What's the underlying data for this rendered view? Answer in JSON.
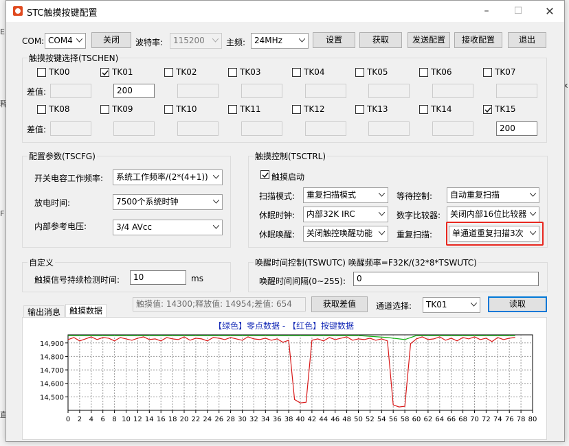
{
  "window": {
    "title": "STC触摸按键配置"
  },
  "toolbar": {
    "com_label": "COM:",
    "com_value": "COM4",
    "close_label": "关闭",
    "baud_label": "波特率:",
    "baud_value": "115200",
    "freq_label": "主频:",
    "freq_value": "24MHz",
    "set_label": "设置",
    "get_label": "获取",
    "send_config_label": "发送配置",
    "receive_config_label": "接收配置",
    "exit_label": "退出"
  },
  "tschen": {
    "title": "触摸按键选择(TSCHEN)",
    "diff_label": "差值:",
    "keys": [
      {
        "name": "TK00",
        "checked": false,
        "value": ""
      },
      {
        "name": "TK01",
        "checked": true,
        "value": "200"
      },
      {
        "name": "TK02",
        "checked": false,
        "value": ""
      },
      {
        "name": "TK03",
        "checked": false,
        "value": ""
      },
      {
        "name": "TK04",
        "checked": false,
        "value": ""
      },
      {
        "name": "TK05",
        "checked": false,
        "value": ""
      },
      {
        "name": "TK06",
        "checked": false,
        "value": ""
      },
      {
        "name": "TK07",
        "checked": false,
        "value": ""
      },
      {
        "name": "TK08",
        "checked": false,
        "value": ""
      },
      {
        "name": "TK09",
        "checked": false,
        "value": ""
      },
      {
        "name": "TK10",
        "checked": false,
        "value": ""
      },
      {
        "name": "TK11",
        "checked": false,
        "value": ""
      },
      {
        "name": "TK12",
        "checked": false,
        "value": ""
      },
      {
        "name": "TK13",
        "checked": false,
        "value": ""
      },
      {
        "name": "TK14",
        "checked": false,
        "value": ""
      },
      {
        "name": "TK15",
        "checked": true,
        "value": "200"
      }
    ]
  },
  "tscfg": {
    "title": "配置参数(TSCFG)",
    "switch_cap_label": "开关电容工作频率:",
    "switch_cap_value": "系统工作频率/(2*(4+1))",
    "discharge_label": "放电时间:",
    "discharge_value": "7500个系统时钟",
    "vref_label": "内部参考电压:",
    "vref_value": "3/4 AVcc"
  },
  "tsctrl": {
    "title": "触摸控制(TSCTRL)",
    "enable_label": "触摸启动",
    "enable_checked": true,
    "scan_mode_label": "扫描模式:",
    "scan_mode_value": "重复扫描模式",
    "wait_ctrl_label": "等待控制:",
    "wait_ctrl_value": "自动重复扫描",
    "sleep_clock_label": "休眠时钟:",
    "sleep_clock_value": "内部32K IRC",
    "comparator_label": "数字比较器:",
    "comparator_value": "关闭内部16位比较器",
    "sleep_wake_label": "休眠唤醒:",
    "sleep_wake_value": "关闭触控唤醒功能",
    "repeat_scan_label": "重复扫描:",
    "repeat_scan_value": "单通道重复扫描3次"
  },
  "custom": {
    "title": "自定义",
    "duration_label": "触摸信号持续检测时间:",
    "duration_value": "10",
    "duration_unit": "ms"
  },
  "tswutc": {
    "title": "唤醒时间控制(TSWUTC) 唤醒频率=F32K/(32*8*TSWUTC)",
    "interval_label": "唤醒时间间隔(0~255):",
    "interval_value": "0"
  },
  "tabs": {
    "output": "输出消息",
    "touch_data": "触摸数据"
  },
  "status": {
    "readout": "触摸值: 14300;释放值: 14954;差值: 654",
    "get_diff_label": "获取差值",
    "channel_label": "通道选择:",
    "channel_value": "TK01",
    "read_label": "读取"
  },
  "colors": {
    "zero_line": "#13b013",
    "key_line": "#d81818",
    "highlight": "#e8271f",
    "title_blue": "#1a2fb8"
  },
  "chart_data": {
    "type": "line",
    "title_parts": [
      "【绿色】零点数据 - 【红色】按键数据"
    ],
    "xlim": [
      0,
      80
    ],
    "ylim": [
      14400,
      14960
    ],
    "x_ticks": [
      0,
      2,
      4,
      6,
      8,
      10,
      12,
      14,
      16,
      18,
      20,
      22,
      24,
      26,
      28,
      30,
      32,
      34,
      36,
      38,
      40,
      42,
      44,
      46,
      48,
      50,
      52,
      54,
      56,
      58,
      60,
      62,
      64,
      66,
      68,
      70,
      72,
      74,
      76,
      78,
      80
    ],
    "y_ticks": [
      14500,
      14600,
      14700,
      14800,
      14900
    ],
    "y_tick_labels": [
      "14,500",
      "14,600",
      "14,700",
      "14,800",
      "14,900"
    ],
    "grid": true,
    "series": [
      {
        "name": "零点数据",
        "color": "#13b013",
        "x": [
          0,
          5,
          10,
          15,
          20,
          25,
          30,
          35,
          40,
          45,
          50,
          55,
          58,
          60,
          65,
          70,
          77
        ],
        "y": [
          14955,
          14955,
          14955,
          14955,
          14955,
          14955,
          14955,
          14955,
          14955,
          14955,
          14955,
          14940,
          14925,
          14955,
          14955,
          14955,
          14955
        ]
      },
      {
        "name": "按键数据",
        "color": "#d81818",
        "x": [
          0,
          1,
          2,
          3,
          4,
          5,
          6,
          7,
          8,
          9,
          10,
          11,
          12,
          13,
          14,
          15,
          16,
          17,
          18,
          19,
          20,
          21,
          22,
          23,
          24,
          25,
          26,
          27,
          28,
          29,
          30,
          31,
          32,
          33,
          34,
          35,
          36,
          37,
          38,
          39,
          40,
          41,
          42,
          43,
          44,
          45,
          46,
          47,
          48,
          49,
          50,
          51,
          52,
          53,
          54,
          55,
          56,
          57,
          58,
          59,
          60,
          61,
          62,
          63,
          64,
          65,
          66,
          67,
          68,
          69,
          70,
          71,
          72,
          73,
          74,
          75,
          76,
          77
        ],
        "y": [
          14925,
          14940,
          14915,
          14930,
          14945,
          14925,
          14940,
          14935,
          14915,
          14940,
          14930,
          14920,
          14935,
          14945,
          14925,
          14930,
          14915,
          14940,
          14930,
          14925,
          14945,
          14920,
          14935,
          14930,
          14915,
          14940,
          14935,
          14925,
          14940,
          14930,
          14920,
          14945,
          14930,
          14925,
          14935,
          14920,
          14930,
          14905,
          14920,
          14480,
          14455,
          14460,
          14920,
          14930,
          14915,
          14940,
          14925,
          14935,
          14945,
          14920,
          14930,
          14925,
          14935,
          14920,
          14930,
          14915,
          14440,
          14425,
          14430,
          14895,
          14930,
          14945,
          14925,
          14930,
          14945,
          14920,
          14935,
          14915,
          14940,
          14930,
          14945,
          14925,
          14935,
          14910,
          14940,
          14925,
          14935,
          14940
        ]
      }
    ]
  }
}
